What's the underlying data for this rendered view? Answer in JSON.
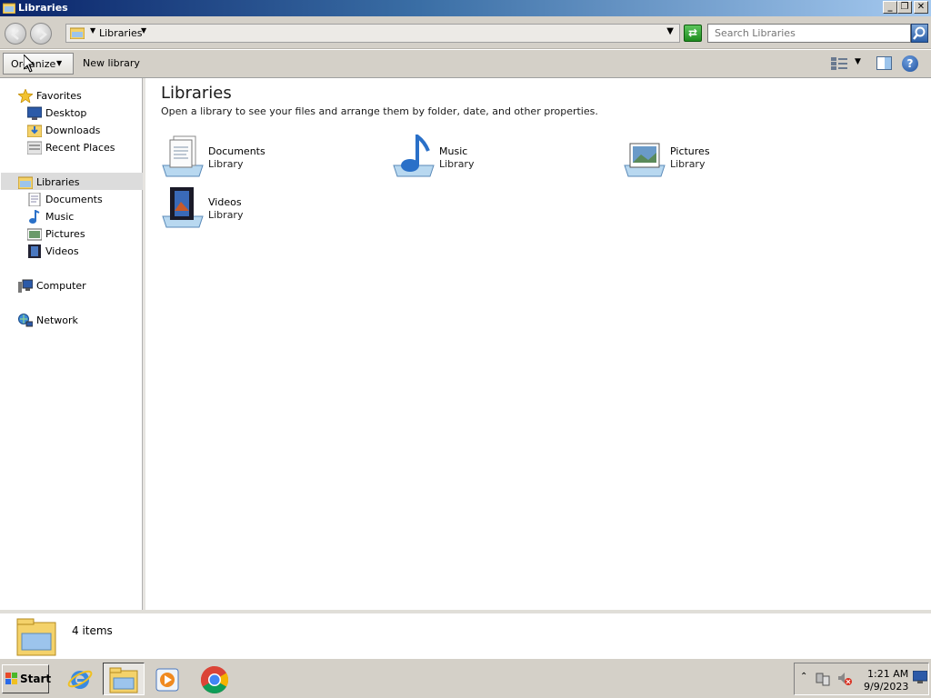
{
  "window": {
    "title": "Libraries",
    "controls": [
      "minimize",
      "restore",
      "close"
    ]
  },
  "address": {
    "crumb": "Libraries",
    "search_placeholder": "Search Libraries"
  },
  "toolbar": {
    "organize_label": "Organize",
    "new_library_label": "New library"
  },
  "nav": {
    "favorites": {
      "label": "Favorites",
      "items": [
        {
          "label": "Desktop",
          "icon": "desktop-icon"
        },
        {
          "label": "Downloads",
          "icon": "downloads-icon"
        },
        {
          "label": "Recent Places",
          "icon": "recent-places-icon"
        }
      ]
    },
    "libraries": {
      "label": "Libraries",
      "selected": true,
      "items": [
        {
          "label": "Documents",
          "icon": "documents-icon"
        },
        {
          "label": "Music",
          "icon": "music-icon"
        },
        {
          "label": "Pictures",
          "icon": "pictures-icon"
        },
        {
          "label": "Videos",
          "icon": "videos-icon"
        }
      ]
    },
    "computer": {
      "label": "Computer"
    },
    "network": {
      "label": "Network"
    }
  },
  "main": {
    "title": "Libraries",
    "description": "Open a library to see your files and arrange them by folder, date, and other properties.",
    "libraries": [
      {
        "name": "Documents",
        "type": "Library",
        "icon": "documents-library-icon"
      },
      {
        "name": "Music",
        "type": "Library",
        "icon": "music-library-icon"
      },
      {
        "name": "Pictures",
        "type": "Library",
        "icon": "pictures-library-icon"
      },
      {
        "name": "Videos",
        "type": "Library",
        "icon": "videos-library-icon"
      }
    ]
  },
  "details": {
    "item_count": "4 items"
  },
  "taskbar": {
    "start_label": "Start",
    "apps": [
      "internet-explorer-icon",
      "windows-explorer-icon",
      "media-player-icon",
      "chrome-icon"
    ],
    "clock_time": "1:21 AM",
    "clock_date": "9/9/2023"
  },
  "colors": {
    "title_gradient_start": "#0a246a",
    "title_gradient_end": "#a6caf0",
    "chrome_gray": "#d4d0c8",
    "selection_gray": "#dcdcdc"
  }
}
